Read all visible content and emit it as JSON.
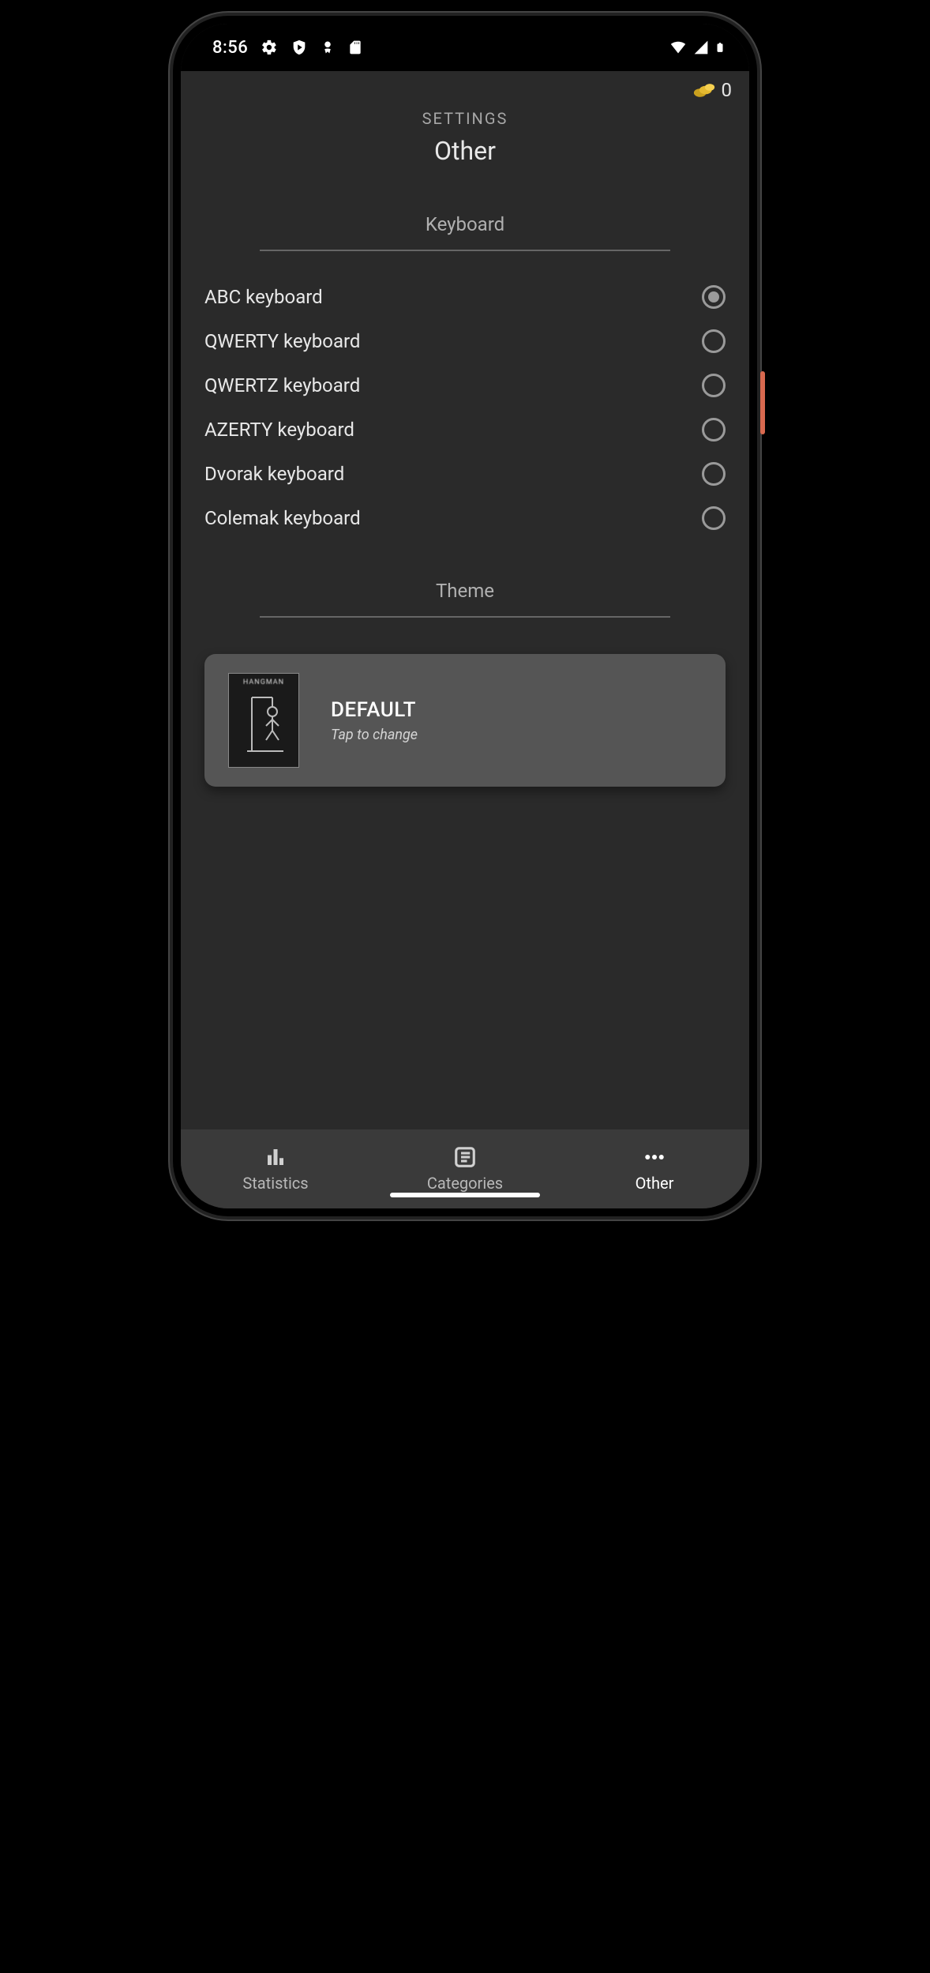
{
  "status": {
    "time": "8:56"
  },
  "coins": {
    "value": "0"
  },
  "header": {
    "eyebrow": "SETTINGS",
    "title": "Other"
  },
  "sections": {
    "keyboard": {
      "title": "Keyboard"
    },
    "theme": {
      "title": "Theme"
    }
  },
  "keyboard_options": [
    {
      "label": "ABC keyboard",
      "selected": true
    },
    {
      "label": "QWERTY keyboard",
      "selected": false
    },
    {
      "label": "QWERTZ keyboard",
      "selected": false
    },
    {
      "label": "AZERTY keyboard",
      "selected": false
    },
    {
      "label": "Dvorak keyboard",
      "selected": false
    },
    {
      "label": "Colemak keyboard",
      "selected": false
    }
  ],
  "theme_card": {
    "thumb_text": "HANGMAN",
    "name": "DEFAULT",
    "hint": "Tap to change"
  },
  "nav": {
    "items": [
      {
        "label": "Statistics",
        "active": false
      },
      {
        "label": "Categories",
        "active": false
      },
      {
        "label": "Other",
        "active": true
      }
    ]
  }
}
